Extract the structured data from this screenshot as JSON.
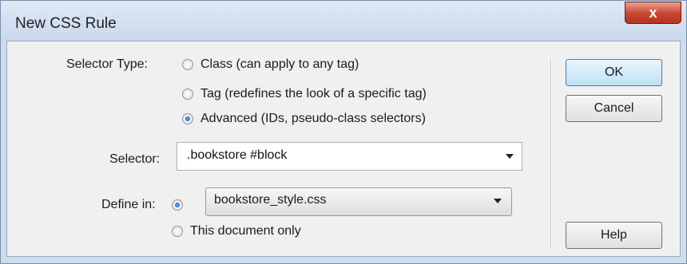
{
  "dialog": {
    "title": "New CSS Rule",
    "close_glyph": "x"
  },
  "selector_type": {
    "label": "Selector Type:",
    "options": [
      {
        "label": "Class (can apply to any tag)",
        "checked": false
      },
      {
        "label": "Tag (redefines the look of a specific tag)",
        "checked": false
      },
      {
        "label": "Advanced (IDs, pseudo-class selectors)",
        "checked": true
      }
    ]
  },
  "selector": {
    "label": "Selector:",
    "value": ".bookstore #block"
  },
  "define_in": {
    "label": "Define in:",
    "file_value": "bookstore_style.css",
    "file_checked": true,
    "document_label": "This document only",
    "document_checked": false
  },
  "buttons": {
    "ok": "OK",
    "cancel": "Cancel",
    "help": "Help"
  },
  "icons": {
    "close": "close-icon",
    "dropdown": "chevron-down-icon"
  }
}
